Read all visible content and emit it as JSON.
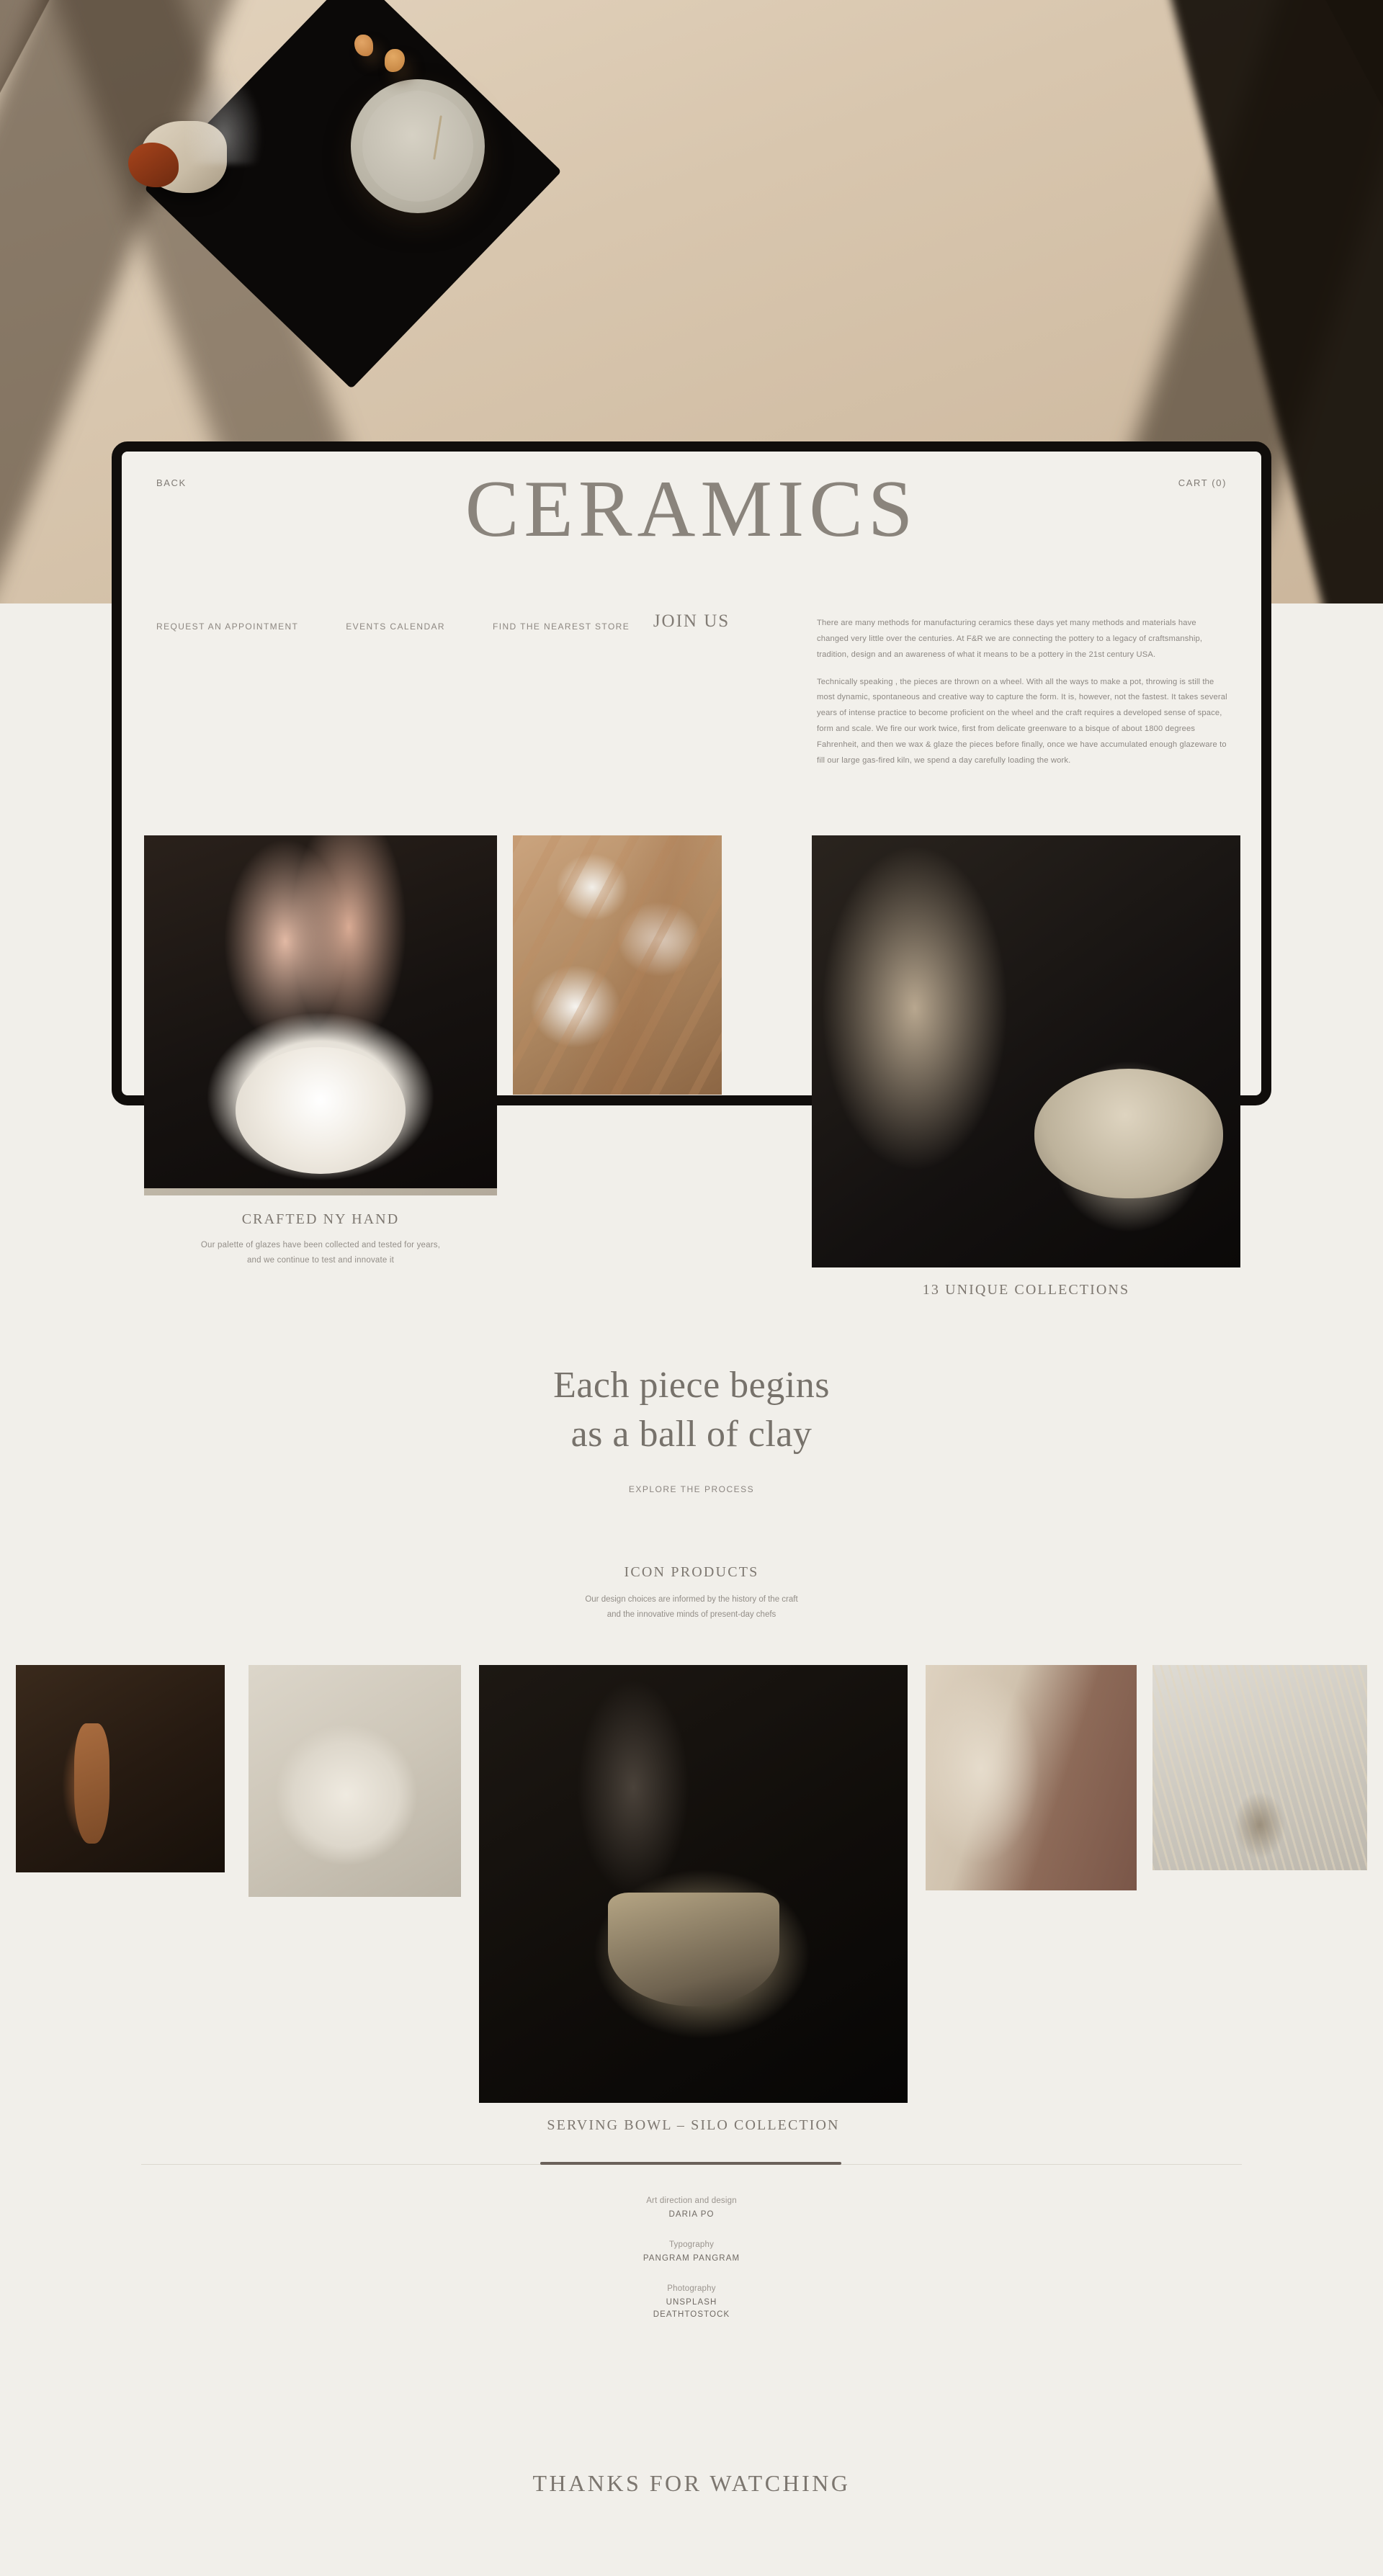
{
  "header": {
    "back_label": "BACK",
    "cart_label": "CART (0)",
    "brand_title": "CERAMICS"
  },
  "nav": {
    "items": [
      {
        "label": "REQUEST AN APPOINTMENT"
      },
      {
        "label": "EVENTS CALENDAR"
      },
      {
        "label": "FIND THE NEAREST STORE"
      }
    ],
    "join_label": "JOIN US"
  },
  "intro": {
    "paragraph_1": "There are many methods for manufacturing ceramics these days yet many methods and materials have changed very little over the centuries. At F&R we are connecting the pottery to a legacy of craftsmanship, tradition, design and an awareness of what it means to be a pottery in the 21st century USA.",
    "paragraph_2": "Technically speaking , the pieces are thrown on a wheel. With all the ways to make a pot, throwing is still the most dynamic, spontaneous and creative way to capture the form. It is, however, not the fastest. It takes several years of intense practice to become proficient on the wheel and the craft requires a developed sense of space, form and scale. We fire our work twice, first from delicate greenware to a bisque of about 1800 degrees Fahrenheit, and then we wax & glaze the pieces before finally, once we have accumulated enough glazeware to fill our large gas-fired kiln, we spend a day carefully loading the work."
  },
  "captions": {
    "crafted_title": "CRAFTED NY HAND",
    "crafted_sub_line1": "Our palette of glazes have been collected and tested for years,",
    "crafted_sub_line2": "and we continue to test and innovate it",
    "collections_title": "13 UNIQUE COLLECTIONS"
  },
  "statement": {
    "line1": "Each piece begins",
    "line2": "as a ball of clay",
    "cta_label": "EXPLORE THE PROCESS"
  },
  "icon_products": {
    "title": "ICON PRODUCTS",
    "sub_line1": "Our design choices are informed by the history of the craft",
    "sub_line2": "and the innovative minds of present-day chefs",
    "bowl_caption": "SERVING BOWL – SILO COLLECTION"
  },
  "credits": [
    {
      "role": "Art direction and design",
      "names": [
        "DARIA PO"
      ]
    },
    {
      "role": "Typography",
      "names": [
        "PANGRAM PANGRAM"
      ]
    },
    {
      "role": "Photography",
      "names": [
        "UNSPLASH",
        "DEATHTOSTOCK"
      ]
    }
  ],
  "footer": {
    "thanks": "THANKS FOR WATCHING"
  },
  "colors": {
    "page_background": "#f1efea",
    "card_background": "#f2f0eb",
    "card_border": "#100d0b",
    "text_muted": "#8d8883",
    "text_heading": "#77726b",
    "divider": "#dcd8d0",
    "divider_active": "#6b615a"
  }
}
